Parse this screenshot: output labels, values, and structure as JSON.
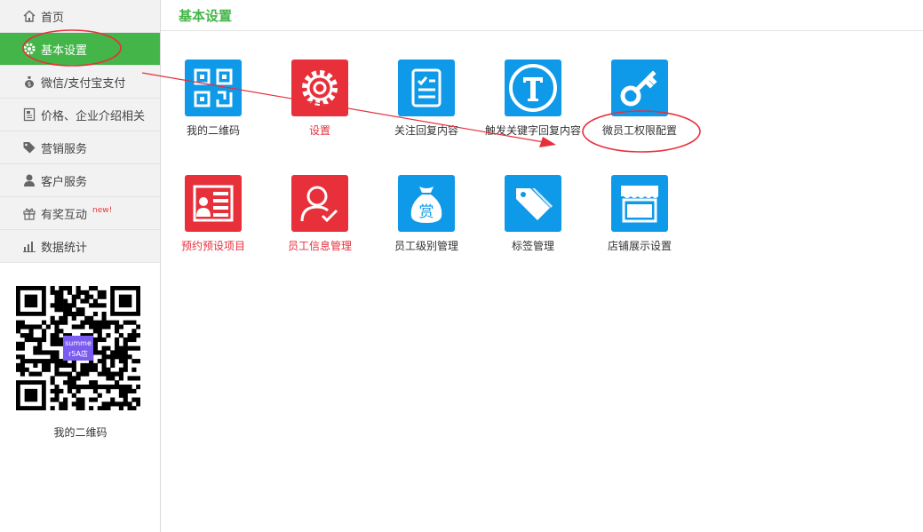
{
  "sidebar": {
    "items": [
      {
        "label": "首页",
        "icon": "home-icon"
      },
      {
        "label": "基本设置",
        "icon": "gear-icon"
      },
      {
        "label": "微信/支付宝支付",
        "icon": "money-bag-icon"
      },
      {
        "label": "价格、企业介绍相关",
        "icon": "document-icon"
      },
      {
        "label": "营销服务",
        "icon": "tag-icon"
      },
      {
        "label": "客户服务",
        "icon": "person-icon"
      },
      {
        "label": "有奖互动",
        "icon": "gift-icon",
        "badge": "new!"
      },
      {
        "label": "数据统计",
        "icon": "bar-chart-icon"
      }
    ],
    "qr_label": "我的二维码",
    "qr_center_text": [
      "summe",
      "r5A店"
    ]
  },
  "header": {
    "title": "基本设置"
  },
  "tiles": [
    {
      "label": "我的二维码",
      "icon": "qr-code-icon",
      "color": "#0e9ae8"
    },
    {
      "label": "设置",
      "icon": "gear-icon",
      "color": "#e8303b"
    },
    {
      "label": "关注回复内容",
      "icon": "checklist-icon",
      "color": "#0e9ae8"
    },
    {
      "label": "触发关键字回复内容",
      "icon": "letter-t-icon",
      "color": "#0e9ae8"
    },
    {
      "label": "微员工权限配置",
      "icon": "key-icon",
      "color": "#0e9ae8"
    },
    {
      "label": "预约预设项目",
      "icon": "reservation-icon",
      "color": "#e8303b"
    },
    {
      "label": "员工信息管理",
      "icon": "user-check-icon",
      "color": "#e8303b"
    },
    {
      "label": "员工级别管理",
      "icon": "reward-bag-icon",
      "color": "#0e9ae8",
      "glyph": "赏"
    },
    {
      "label": "标签管理",
      "icon": "tags-icon",
      "color": "#0e9ae8"
    },
    {
      "label": "店铺展示设置",
      "icon": "storefront-icon",
      "color": "#0e9ae8"
    }
  ],
  "colors": {
    "accent_green": "#44b549",
    "annotation_red": "#e8303b"
  }
}
